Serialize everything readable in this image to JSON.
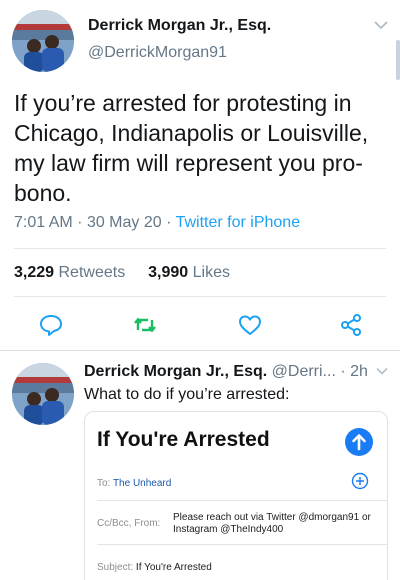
{
  "main_tweet": {
    "author_name": "Derrick Morgan Jr., Esq.",
    "handle": "@DerrickMorgan91",
    "text": "If you’re arrested for protesting in Chicago, Indianapolis or Louisville, my law firm will represent you pro-bono.",
    "time": "7:01 AM",
    "date": "30 May 20",
    "separator": "·",
    "source": "Twitter for iPhone",
    "retweets_count": "3,229",
    "retweets_label": "Retweets",
    "likes_count": "3,990",
    "likes_label": "Likes",
    "icons": [
      "reply-icon",
      "retweet-icon",
      "like-icon",
      "share-icon"
    ]
  },
  "reply_tweet": {
    "author_name": "Derrick Morgan Jr., Esq.",
    "handle": "@Derri...",
    "separator": "·",
    "age": "2h",
    "text": "What to do if you’re arrested:",
    "email_card": {
      "title": "If You're Arrested",
      "to_label": "To:",
      "to_value": "The Unheard",
      "cc_label": "Cc/Bcc, From:",
      "cc_value": "Please reach out via Twitter @dmorgan91 or Instagram @TheIndy400",
      "subject_label": "Subject:",
      "subject_value": "If You're Arrested"
    }
  },
  "colors": {
    "accent": "#1da1f2",
    "secondary_text": "#657786",
    "primary_text": "#14171a",
    "mail_send": "#1a7cf5"
  }
}
